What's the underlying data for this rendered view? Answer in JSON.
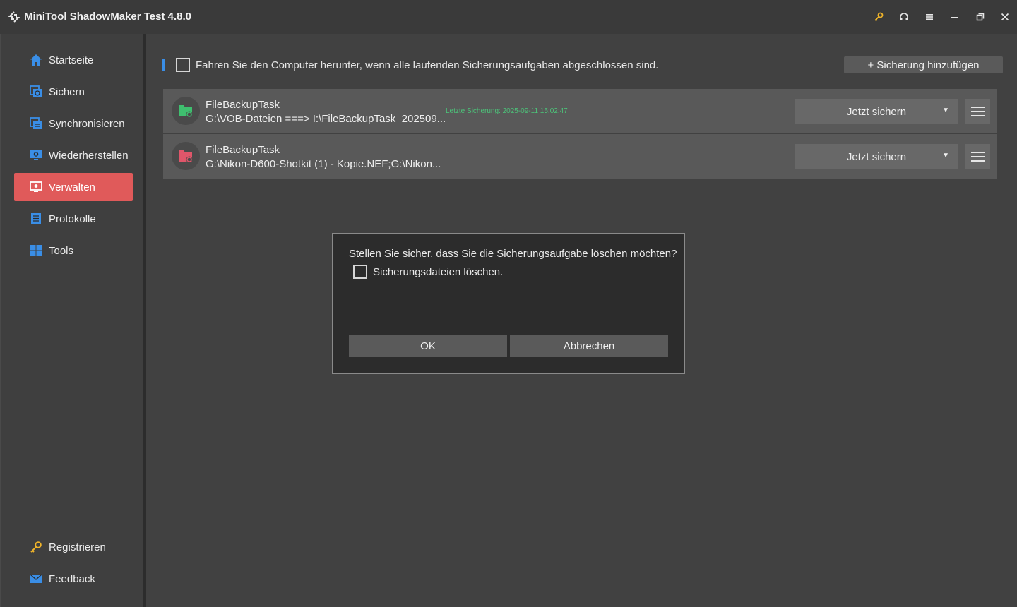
{
  "app": {
    "title": "MiniTool ShadowMaker Test 4.8.0"
  },
  "titlebar_icons": [
    "key-icon",
    "headset-icon",
    "menu-icon",
    "minimize-icon",
    "restore-icon",
    "close-icon"
  ],
  "sidebar": {
    "items": [
      {
        "label": "Startseite",
        "icon": "home-icon"
      },
      {
        "label": "Sichern",
        "icon": "backup-icon"
      },
      {
        "label": "Synchronisieren",
        "icon": "sync-icon"
      },
      {
        "label": "Wiederherstellen",
        "icon": "restore-icon"
      },
      {
        "label": "Verwalten",
        "icon": "manage-icon",
        "active": true
      },
      {
        "label": "Protokolle",
        "icon": "log-icon"
      },
      {
        "label": "Tools",
        "icon": "tools-icon"
      }
    ],
    "bottom": [
      {
        "label": "Registrieren",
        "icon": "key-icon"
      },
      {
        "label": "Feedback",
        "icon": "mail-icon"
      }
    ]
  },
  "main": {
    "shutdown_label": "Fahren Sie den Computer herunter, wenn alle laufenden Sicherungsaufgaben abgeschlossen sind.",
    "add_button": "+ Sicherung hinzufügen",
    "tasks": [
      {
        "name": "FileBackupTask",
        "path": "G:\\VOB-Dateien ===> I:\\FileBackupTask_202509...",
        "last_backup": "Letzte Sicherung: 2025-09-11 15:02:47",
        "action": "Jetzt sichern",
        "status_color": "#3fbf6f"
      },
      {
        "name": "FileBackupTask",
        "path": "G:\\Nikon-D600-Shotkit (1) - Kopie.NEF;G:\\Nikon...",
        "last_backup": "",
        "action": "Jetzt sichern",
        "status_color": "#e0566a"
      }
    ]
  },
  "dialog": {
    "message": "Stellen Sie sicher, dass Sie die Sicherungsaufgabe löschen möchten?",
    "checkbox_label": "Sicherungsdateien löschen.",
    "ok": "OK",
    "cancel": "Abbrechen"
  },
  "colors": {
    "accent": "#e05a5a",
    "blue": "#3a8ee6",
    "key": "#f0b429"
  }
}
